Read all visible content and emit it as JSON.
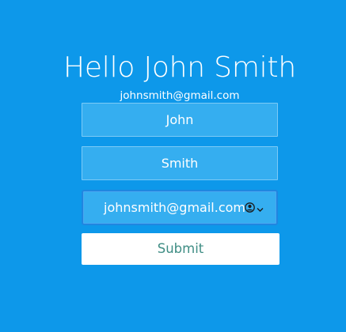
{
  "header": {
    "title": "Hello John Smith",
    "subtitle": "johnsmith@gmail.com"
  },
  "form": {
    "first_name_value": "John",
    "last_name_value": "Smith",
    "email_value": "johnsmith@gmail.com",
    "email_autofill_icon": "user-circle-icon",
    "email_dropdown_icon": "chevron-down-icon",
    "submit_label": "Submit"
  },
  "colors": {
    "background": "#0d98ea",
    "field_background": "#35aef0",
    "submit_text": "#3f8d84"
  }
}
